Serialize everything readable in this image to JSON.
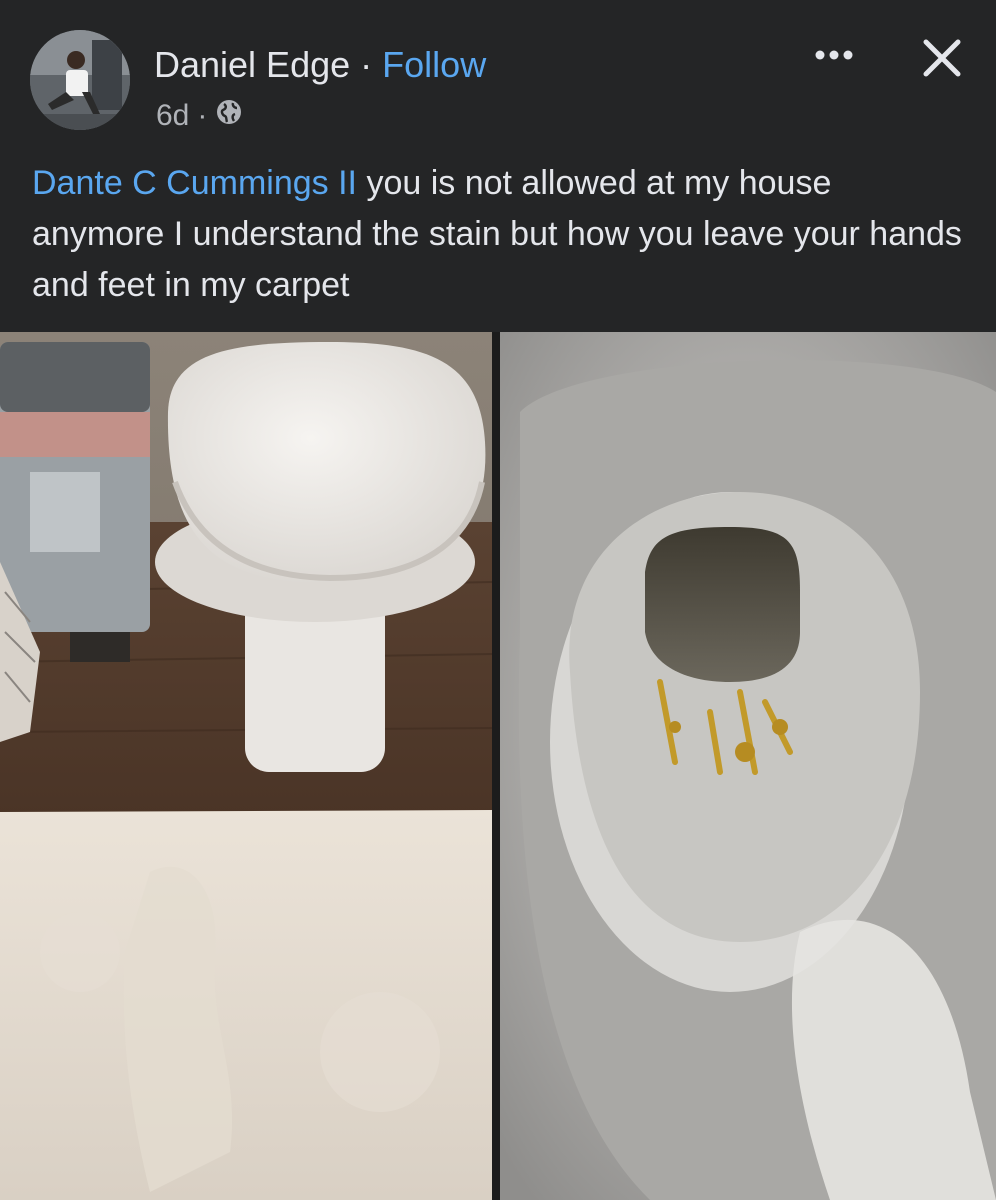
{
  "post": {
    "author": "Daniel Edge",
    "separator": "·",
    "follow_label": "Follow",
    "time": "6d",
    "time_separator": "·",
    "privacy_icon": "globe-icon",
    "more_icon": "more-options-icon",
    "close_icon": "close-icon",
    "mention": "Dante C Cummings II",
    "text": "you is not allowed at my house anymore I understand the stain but how you leave your hands and feet in my carpet",
    "photos": [
      "bathroom-rug-photo",
      "toilet-bowl-photo"
    ]
  },
  "colors": {
    "background": "#242526",
    "text": "#e4e6eb",
    "secondary_text": "#b0b3b8",
    "link": "#5aa7f0"
  }
}
